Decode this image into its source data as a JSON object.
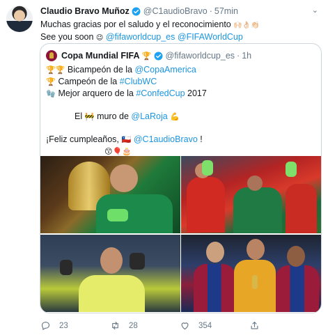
{
  "tweet": {
    "author_name": "Claudio Bravo Muñoz",
    "author_handle": "@C1audioBravo",
    "time": "57min",
    "line1": "Muchas gracias por el saludo y el reconocimiento ",
    "line1_emoji": "🙌🏻👌🏻👏🏻",
    "line2_prefix": "See you soon ",
    "line2_emoji": "😉",
    "link1": "@fifaworldcup_es",
    "link2": "@FIFAWorldCup"
  },
  "quote": {
    "author_name": "Copa Mundial FIFA",
    "name_emoji": "🏆",
    "author_handle": "@fifaworldcup_es",
    "time": "1h",
    "row1_emoji": "🏆🏆",
    "row1_text": " Bicampeón de la ",
    "row1_link": "@CopaAmerica",
    "row2_emoji": "🏆",
    "row2_text": " Campeón de la ",
    "row2_link": "#ClubWC",
    "row3_emoji": "🧤",
    "row3_text": " Mejor arquero de la ",
    "row3_link": "#ConfedCup",
    "row3_suffix": " 2017",
    "row4_a": "El ",
    "row4_emoji": "🚧",
    "row4_b": " muro de ",
    "row4_link": "@LaRoja",
    "row4_emoji2": "💪",
    "row5_text": "¡Feliz cumpleaños, ",
    "row5_flag": "🇨🇱",
    "row5_link": "@C1audioBravo",
    "row5_suffix": " !",
    "row6_emoji": "😙🎈🎂"
  },
  "actions": {
    "reply_count": "23",
    "retweet_count": "28",
    "like_count": "354"
  },
  "icons": {
    "verified": "verified-badge-icon",
    "reply": "reply-icon",
    "retweet": "retweet-icon",
    "like": "heart-icon",
    "share": "share-icon",
    "caret": "chevron-down-icon"
  },
  "colors": {
    "link": "#1b95e0",
    "secondary_text": "#657786",
    "verified": "#1da1f2",
    "border": "#ccd6dd"
  }
}
